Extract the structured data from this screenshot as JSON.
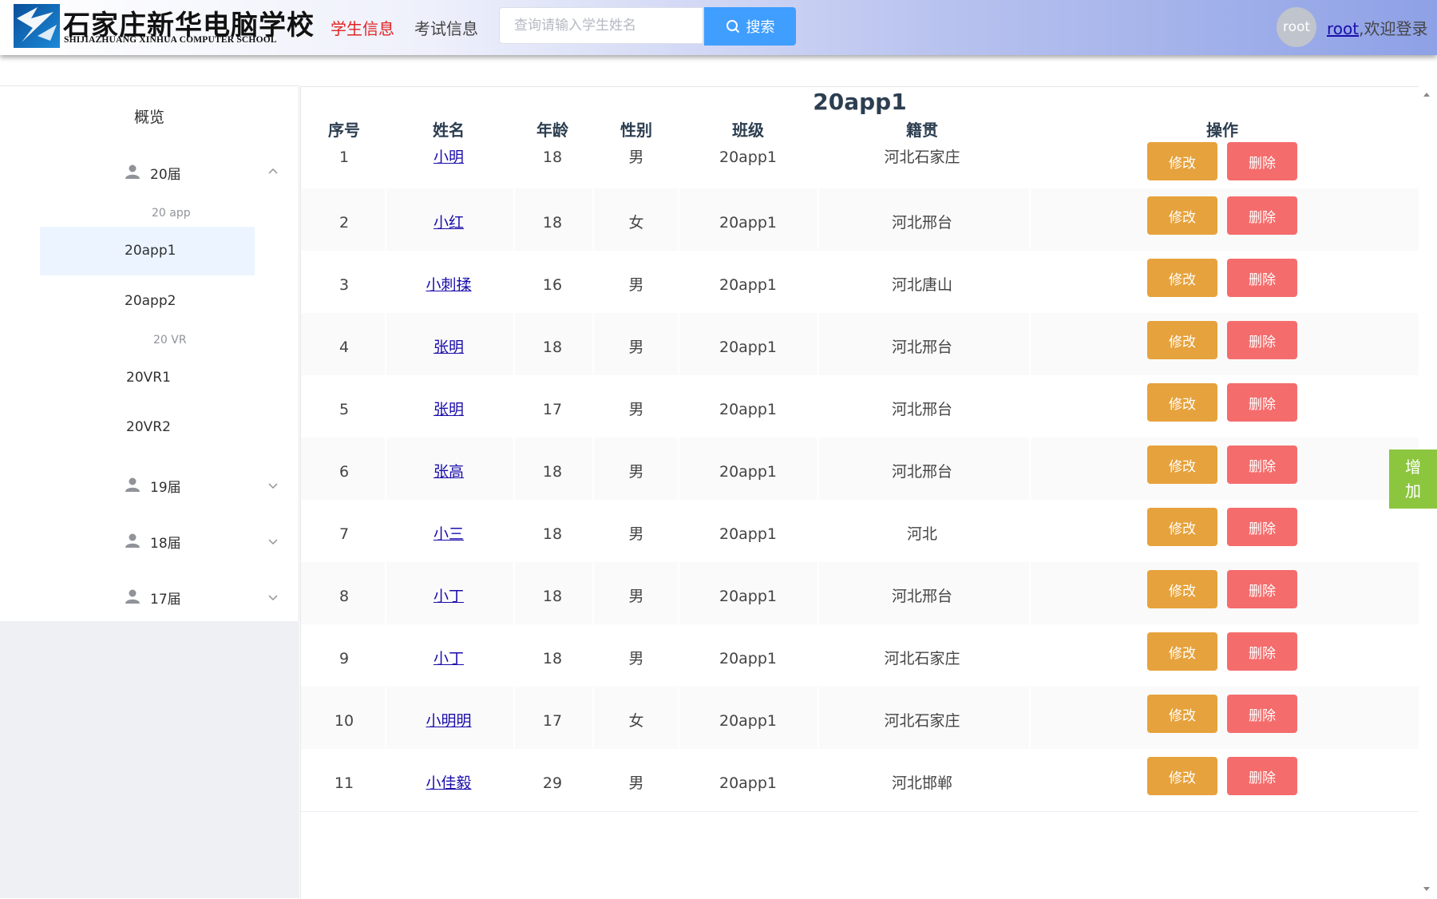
{
  "header": {
    "logo_cn": "石家庄新华电脑学校",
    "logo_en": "SHIJIAZHUANG XINHUA COMPUTER SCHOOL",
    "nav": [
      {
        "label": "学生信息",
        "active": true
      },
      {
        "label": "考试信息",
        "active": false
      }
    ],
    "search": {
      "placeholder": "查询请输入学生姓名",
      "value": "",
      "button_label": "搜索",
      "icon": "search-icon"
    },
    "avatar_text": "root",
    "user_link": "root",
    "welcome_text": ",欢迎登录"
  },
  "sidebar": {
    "overview_label": "概览",
    "groups": [
      {
        "label": "20届",
        "icon": "user-icon",
        "expanded": true,
        "subgroups": [
          {
            "label": "20 app",
            "items": [
              "20app1",
              "20app2"
            ]
          },
          {
            "label": "20 VR",
            "items": [
              "20VR1",
              "20VR2"
            ]
          }
        ]
      },
      {
        "label": "19届",
        "icon": "user-icon",
        "expanded": false
      },
      {
        "label": "18届",
        "icon": "user-icon",
        "expanded": false
      },
      {
        "label": "17届",
        "icon": "user-icon",
        "expanded": false
      }
    ],
    "active_item": "20app1"
  },
  "table": {
    "title": "20app1",
    "columns": [
      "序号",
      "姓名",
      "年龄",
      "性别",
      "班级",
      "籍贯",
      "操作"
    ],
    "edit_label": "修改",
    "delete_label": "删除",
    "rows": [
      {
        "no": "1",
        "name": "小明",
        "age": "18",
        "gender": "男",
        "class": "20app1",
        "origin": "河北石家庄"
      },
      {
        "no": "2",
        "name": "小红",
        "age": "18",
        "gender": "女",
        "class": "20app1",
        "origin": "河北邢台"
      },
      {
        "no": "3",
        "name": "小刺揉",
        "age": "16",
        "gender": "男",
        "class": "20app1",
        "origin": "河北唐山"
      },
      {
        "no": "4",
        "name": "张明",
        "age": "18",
        "gender": "男",
        "class": "20app1",
        "origin": "河北邢台"
      },
      {
        "no": "5",
        "name": "张明",
        "age": "17",
        "gender": "男",
        "class": "20app1",
        "origin": "河北邢台"
      },
      {
        "no": "6",
        "name": "张高",
        "age": "18",
        "gender": "男",
        "class": "20app1",
        "origin": "河北邢台"
      },
      {
        "no": "7",
        "name": "小三",
        "age": "18",
        "gender": "男",
        "class": "20app1",
        "origin": "河北"
      },
      {
        "no": "8",
        "name": "小丁",
        "age": "18",
        "gender": "男",
        "class": "20app1",
        "origin": "河北邢台"
      },
      {
        "no": "9",
        "name": "小丁",
        "age": "18",
        "gender": "男",
        "class": "20app1",
        "origin": "河北石家庄"
      },
      {
        "no": "10",
        "name": "小明明",
        "age": "17",
        "gender": "女",
        "class": "20app1",
        "origin": "河北石家庄"
      },
      {
        "no": "11",
        "name": "小佳毅",
        "age": "29",
        "gender": "男",
        "class": "20app1",
        "origin": "河北邯郸"
      }
    ]
  },
  "add_button": {
    "chars": [
      "增",
      "加"
    ]
  },
  "colors": {
    "edit": "#e6a23c",
    "delete": "#f56c6c",
    "primary": "#409eff",
    "nav_active": "#e02424",
    "add": "#8cc63f"
  }
}
